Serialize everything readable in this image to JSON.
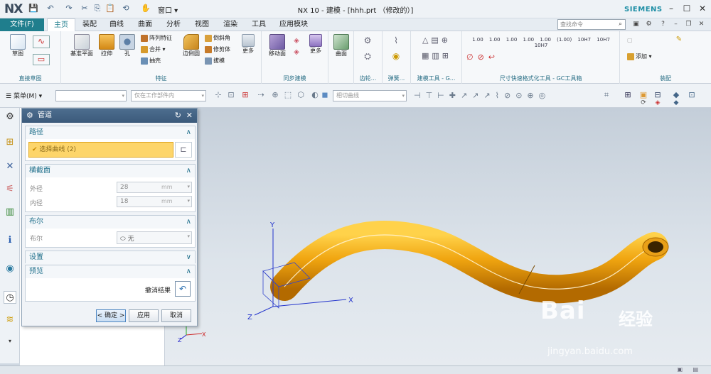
{
  "app": {
    "logo": "NX",
    "title": "NX 10 - 建模 - [hhh.prt （修改的）]",
    "brand": "SIEMENS",
    "window_menu": "窗口"
  },
  "menubar": {
    "file": "文件(F)",
    "tabs": [
      "主页",
      "装配",
      "曲线",
      "曲面",
      "分析",
      "视图",
      "渲染",
      "工具",
      "应用模块"
    ],
    "active_tab": "主页",
    "search_placeholder": "查找命令"
  },
  "ribbon": {
    "groups": [
      {
        "label": "直接草图",
        "items": [
          "草图"
        ]
      },
      {
        "label": "特征",
        "items": [
          "基准平面",
          "拉伸",
          "孔",
          "阵列特征",
          "合并",
          "抽壳",
          "边倒圆",
          "倒斜角",
          "修剪体",
          "拔模",
          "更多"
        ]
      },
      {
        "label": "同步建模",
        "items": [
          "移动面",
          "更多"
        ]
      },
      {
        "label": "",
        "items": [
          "曲面"
        ]
      },
      {
        "label": "齿轮...",
        "items": []
      },
      {
        "label": "弹簧...",
        "items": []
      },
      {
        "label": "建模工具 - G...",
        "items": []
      },
      {
        "label": "尺寸快速格式化工具 - GC工具箱",
        "items": []
      },
      {
        "label": "装配",
        "items": [
          "添加"
        ]
      }
    ]
  },
  "toolbar": {
    "menu": "菜单(M)",
    "filter": "",
    "scope": "仅在工作部件内",
    "curve_rule": "相切曲线"
  },
  "dialog": {
    "title": "管道",
    "path": {
      "header": "路径",
      "select_curve": "选择曲线 (2)"
    },
    "cross_section": {
      "header": "横截面",
      "outer_label": "外径",
      "outer_value": "28",
      "inner_label": "内径",
      "inner_value": "18",
      "unit": "mm"
    },
    "boolean": {
      "header": "布尔",
      "label": "布尔",
      "value": "无"
    },
    "settings": {
      "header": "设置"
    },
    "preview": {
      "header": "预览",
      "undo_label": "撤消结果"
    },
    "buttons": {
      "ok": "< 确定 >",
      "apply": "应用",
      "cancel": "取消"
    }
  },
  "viewport": {
    "axes": {
      "x": "X",
      "y": "Y",
      "z": "Z"
    },
    "pipe_color": "#f0a510"
  },
  "watermark": {
    "brand": "Bai",
    "brand2": "经验",
    "url": "jingyan.baidu.com"
  }
}
